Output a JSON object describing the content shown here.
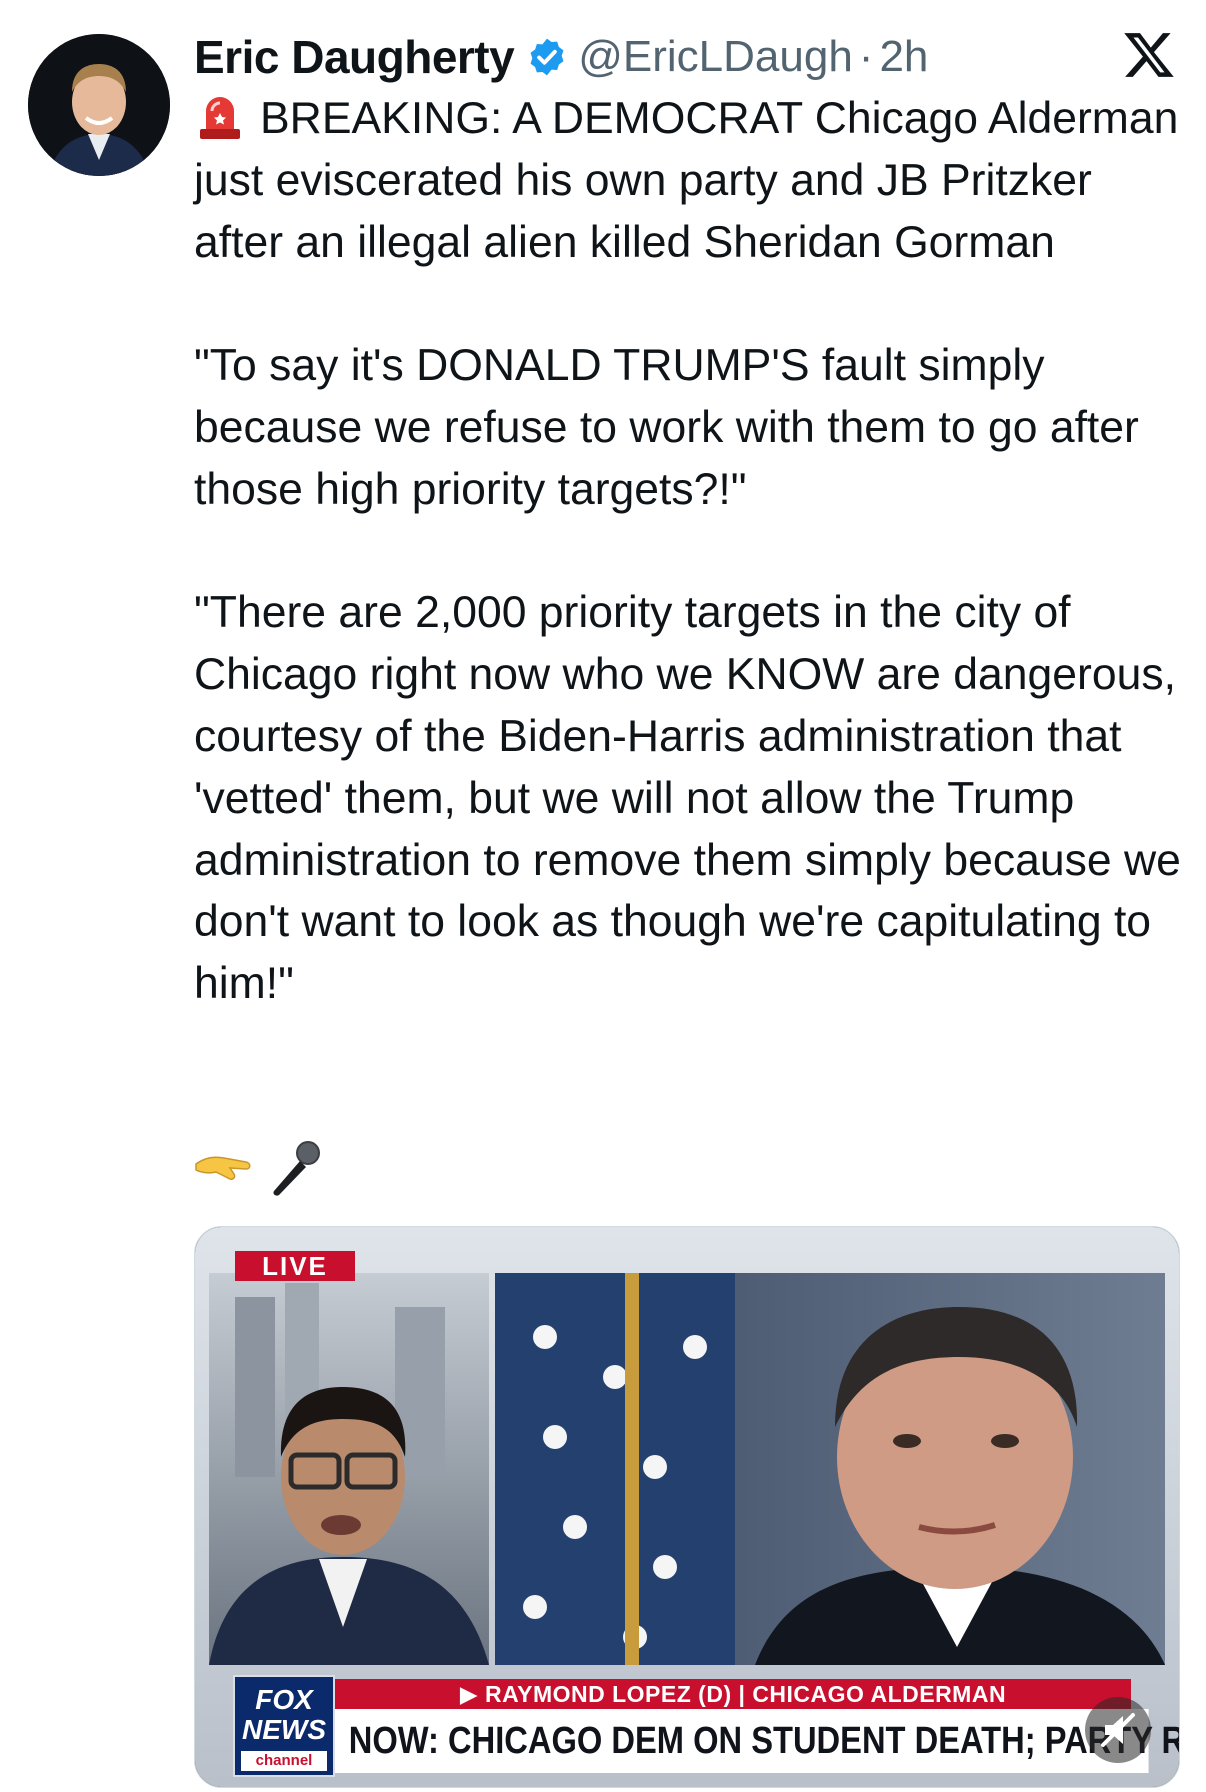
{
  "author": {
    "name": "Eric Daugherty",
    "handle": "@EricLDaugh",
    "separator": "·",
    "time": "2h",
    "verified_icon": "verified-badge-icon",
    "colors": {
      "verified": "#1d9bf0",
      "secondary_text": "#536471"
    }
  },
  "tweet": {
    "line1": "BREAKING: A DEMOCRAT Chicago Alderman just eviscerated his own party and JB Pritzker after an illegal alien killed Sheridan Gorman",
    "quote1": "\"To say it's DONALD TRUMP'S fault simply because we refuse to work with them to go after those high priority targets?!\"",
    "quote2": "\"There are 2,000 priority targets in the city of Chicago right now who we KNOW are dangerous, courtesy of the Biden-Harris administration that 'vetted' them, but we will not allow the Trump administration to remove them simply because we don't want to look as though we're capitulating to him!\"",
    "emojis": [
      "hand-pointing-right-icon",
      "microphone-icon"
    ],
    "lead_emoji": "siren-icon"
  },
  "media": {
    "live_label": "LIVE",
    "lower_third_name": "▶ RAYMOND LOPEZ (D) | CHICAGO ALDERMAN",
    "lower_third_headline": "NOW: CHICAGO DEM ON STUDENT DEATH; PARTY RESPONSE",
    "logo": {
      "top": "FOX",
      "middle": "NEWS",
      "bottom": "channel"
    },
    "colors": {
      "fox_red": "#c8102e",
      "fox_blue": "#0b2a6b"
    }
  }
}
